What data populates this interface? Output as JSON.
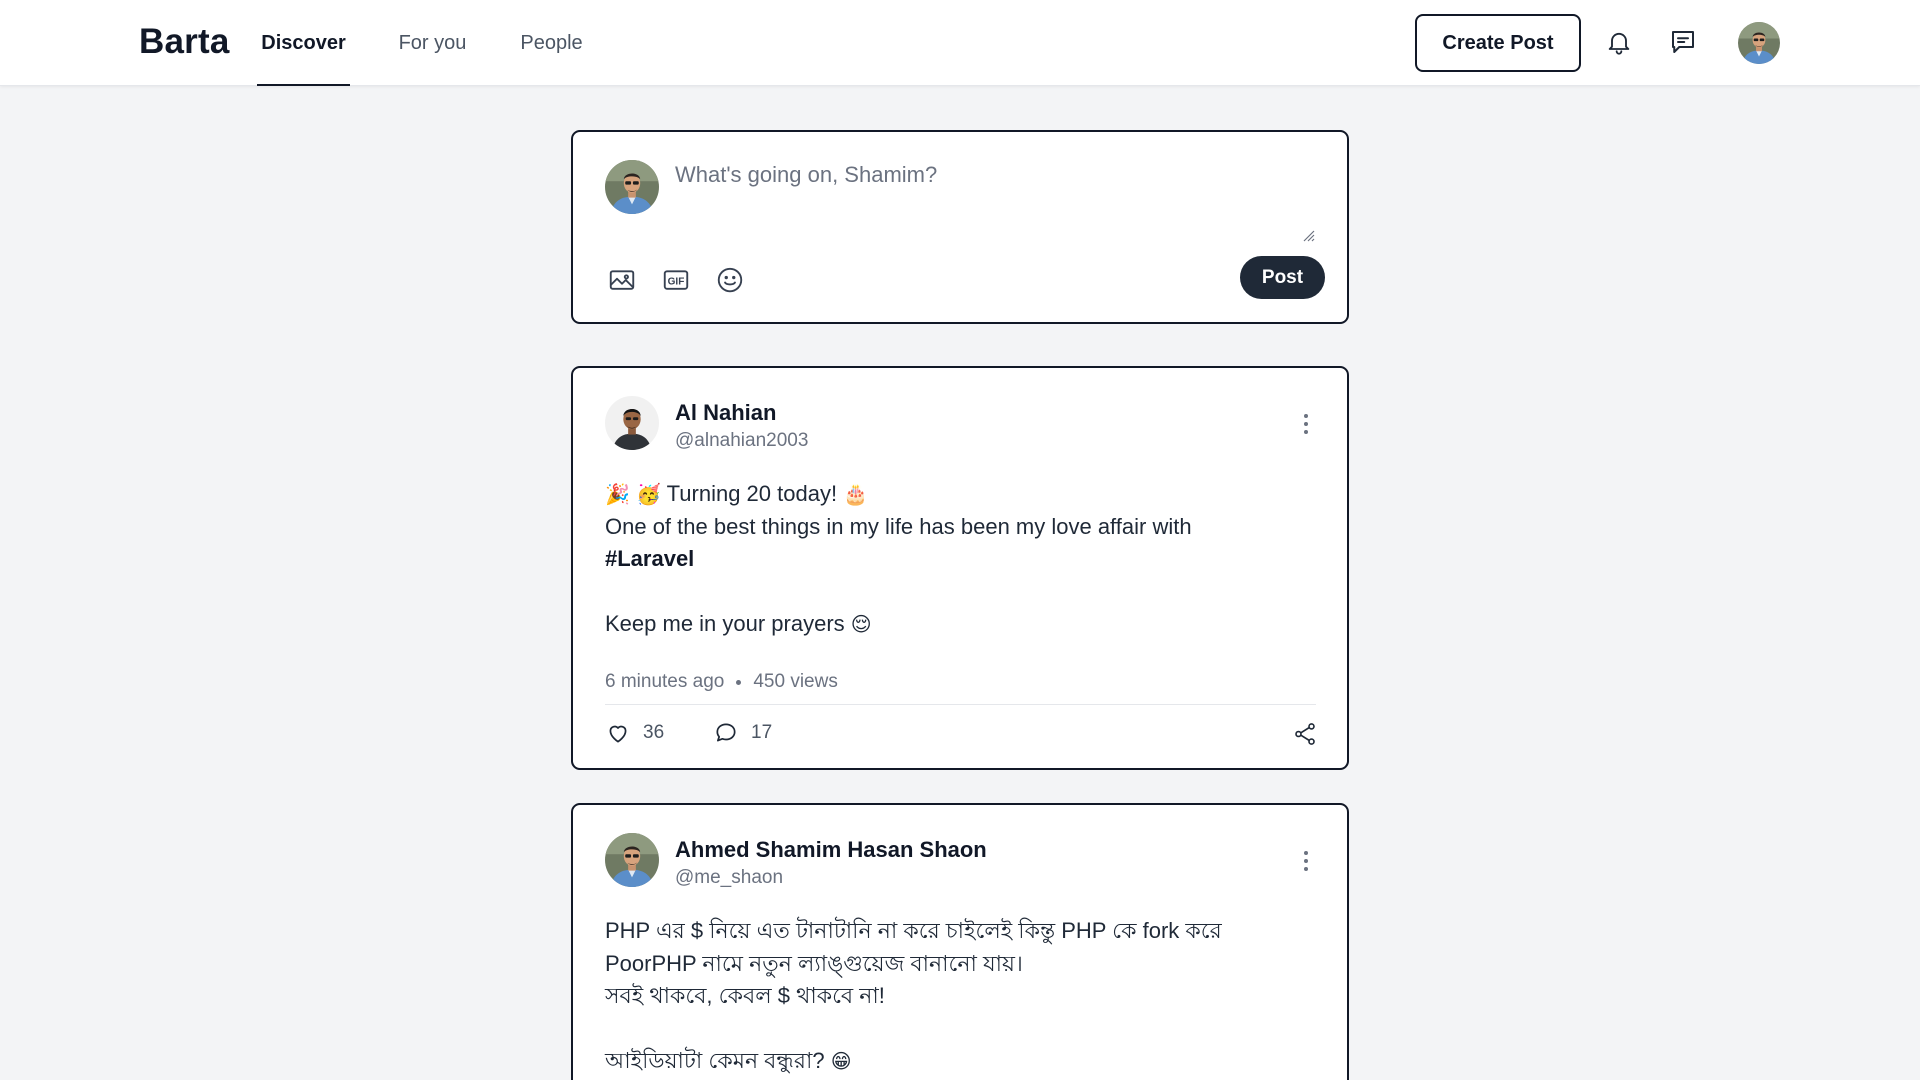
{
  "header": {
    "brand": "Barta",
    "tabs": [
      {
        "label": "Discover",
        "active": true
      },
      {
        "label": "For you",
        "active": false
      },
      {
        "label": "People",
        "active": false
      }
    ],
    "create_post_label": "Create Post",
    "icons": [
      "bell-icon",
      "message-icon",
      "avatar"
    ]
  },
  "composer": {
    "placeholder": "What's going on, Shamim?",
    "post_label": "Post",
    "tools": [
      "image-icon",
      "gif-icon",
      "emoji-icon"
    ],
    "gif_text": "GIF"
  },
  "posts": [
    {
      "author_name": "Al Nahian",
      "author_handle": "@alnahian2003",
      "line1_emoji_a": "🎉",
      "line1_emoji_b": "🥳",
      "line1_text": " Turning 20 today! ",
      "line1_emoji_c": "🎂",
      "line2": "One of the best things in my life has been my love affair with",
      "hashtag": "#Laravel",
      "line4_text": "Keep me in your prayers ",
      "line4_emoji": "😌",
      "time": "6 minutes ago",
      "views": "450 views",
      "likes": "36",
      "comments": "17"
    },
    {
      "author_name": "Ahmed Shamim Hasan Shaon",
      "author_handle": "@me_shaon",
      "line1": "PHP এর $ নিয়ে এত টানাটানি না করে চাইলেই কিন্তু PHP কে fork করে",
      "line2": "PoorPHP নামে নতুন ল্যাঙ্গুয়েজ বানানো যায়।",
      "line3": "সবই থাকবে, কেবল $ থাকবে না!",
      "line5_text": "আইডিয়াটা কেমন বন্ধুরা? ",
      "line5_emoji": "😁"
    }
  ],
  "colors": {
    "page_bg": "#f3f4f6",
    "card_border": "#111827",
    "post_button_bg": "#1f2937",
    "muted_text": "#6b7280"
  }
}
